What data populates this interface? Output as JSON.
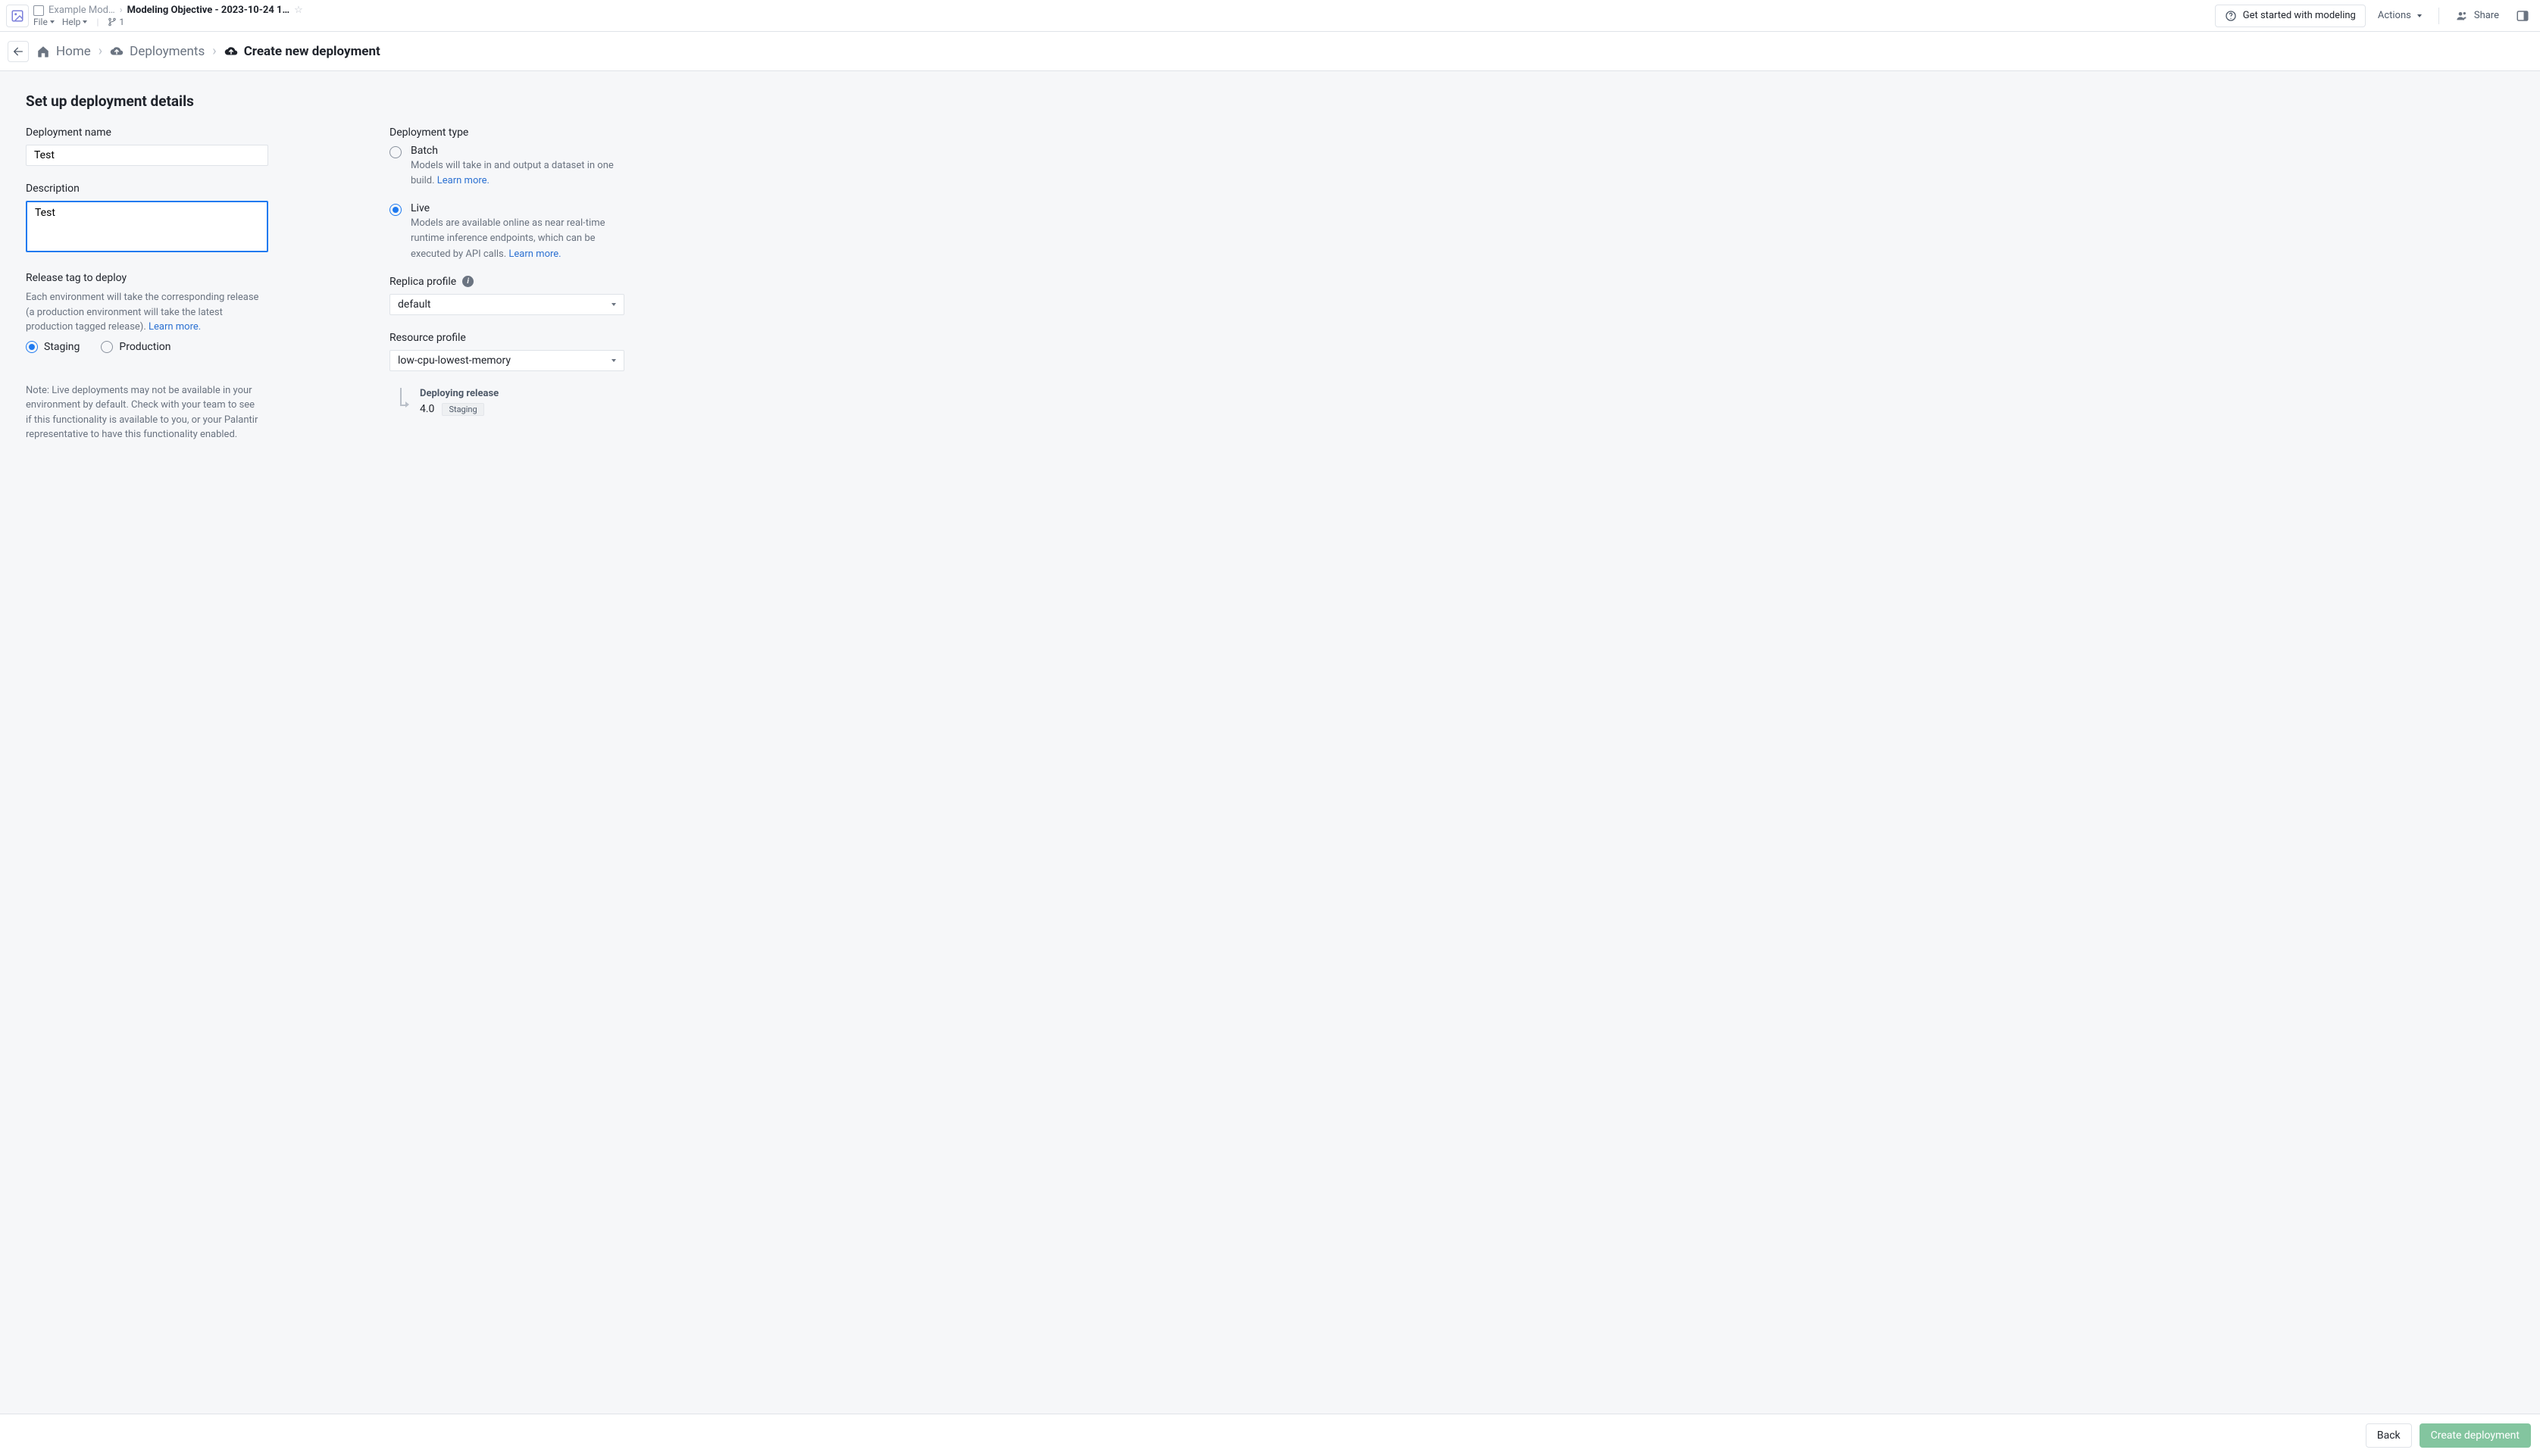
{
  "title": {
    "project": "Example Mod…",
    "objective": "Modeling Objective - 2023-10-24 1…",
    "menu_file": "File",
    "menu_help": "Help",
    "branch_count": "1"
  },
  "header_buttons": {
    "get_started": "Get started with modeling",
    "actions": "Actions",
    "share": "Share"
  },
  "breadcrumbs": {
    "home": "Home",
    "deployments": "Deployments",
    "create": "Create new deployment"
  },
  "page_title": "Set up deployment details",
  "left": {
    "name_label": "Deployment name",
    "name_value": "Test",
    "desc_label": "Description",
    "desc_value": "Test",
    "release_label": "Release tag to deploy",
    "release_hint": "Each environment will take the corresponding release (a production environment will take the latest production tagged release). ",
    "learn_more": "Learn more.",
    "radio_staging": "Staging",
    "radio_production": "Production",
    "note": "Note: Live deployments may not be available in your environment by default. Check with your team to see if this functionality is available to you, or your Palantir representative to have this functionality enabled."
  },
  "right": {
    "type_label": "Deployment type",
    "batch": {
      "title": "Batch",
      "desc": "Models will take in and output a dataset in one build. ",
      "learn_more": "Learn more."
    },
    "live": {
      "title": "Live",
      "desc_a": "Models are available online as near real-time runtime inference endpoints, which can be executed by API calls. ",
      "learn_more": "Learn more."
    },
    "replica_label": "Replica profile",
    "replica_selected": "default",
    "resource_label": "Resource profile",
    "resource_selected": "low-cpu-lowest-memory",
    "deploying_title": "Deploying release",
    "deploying_version": "4.0",
    "deploying_tag": "Staging"
  },
  "footer": {
    "back": "Back",
    "create": "Create deployment"
  }
}
